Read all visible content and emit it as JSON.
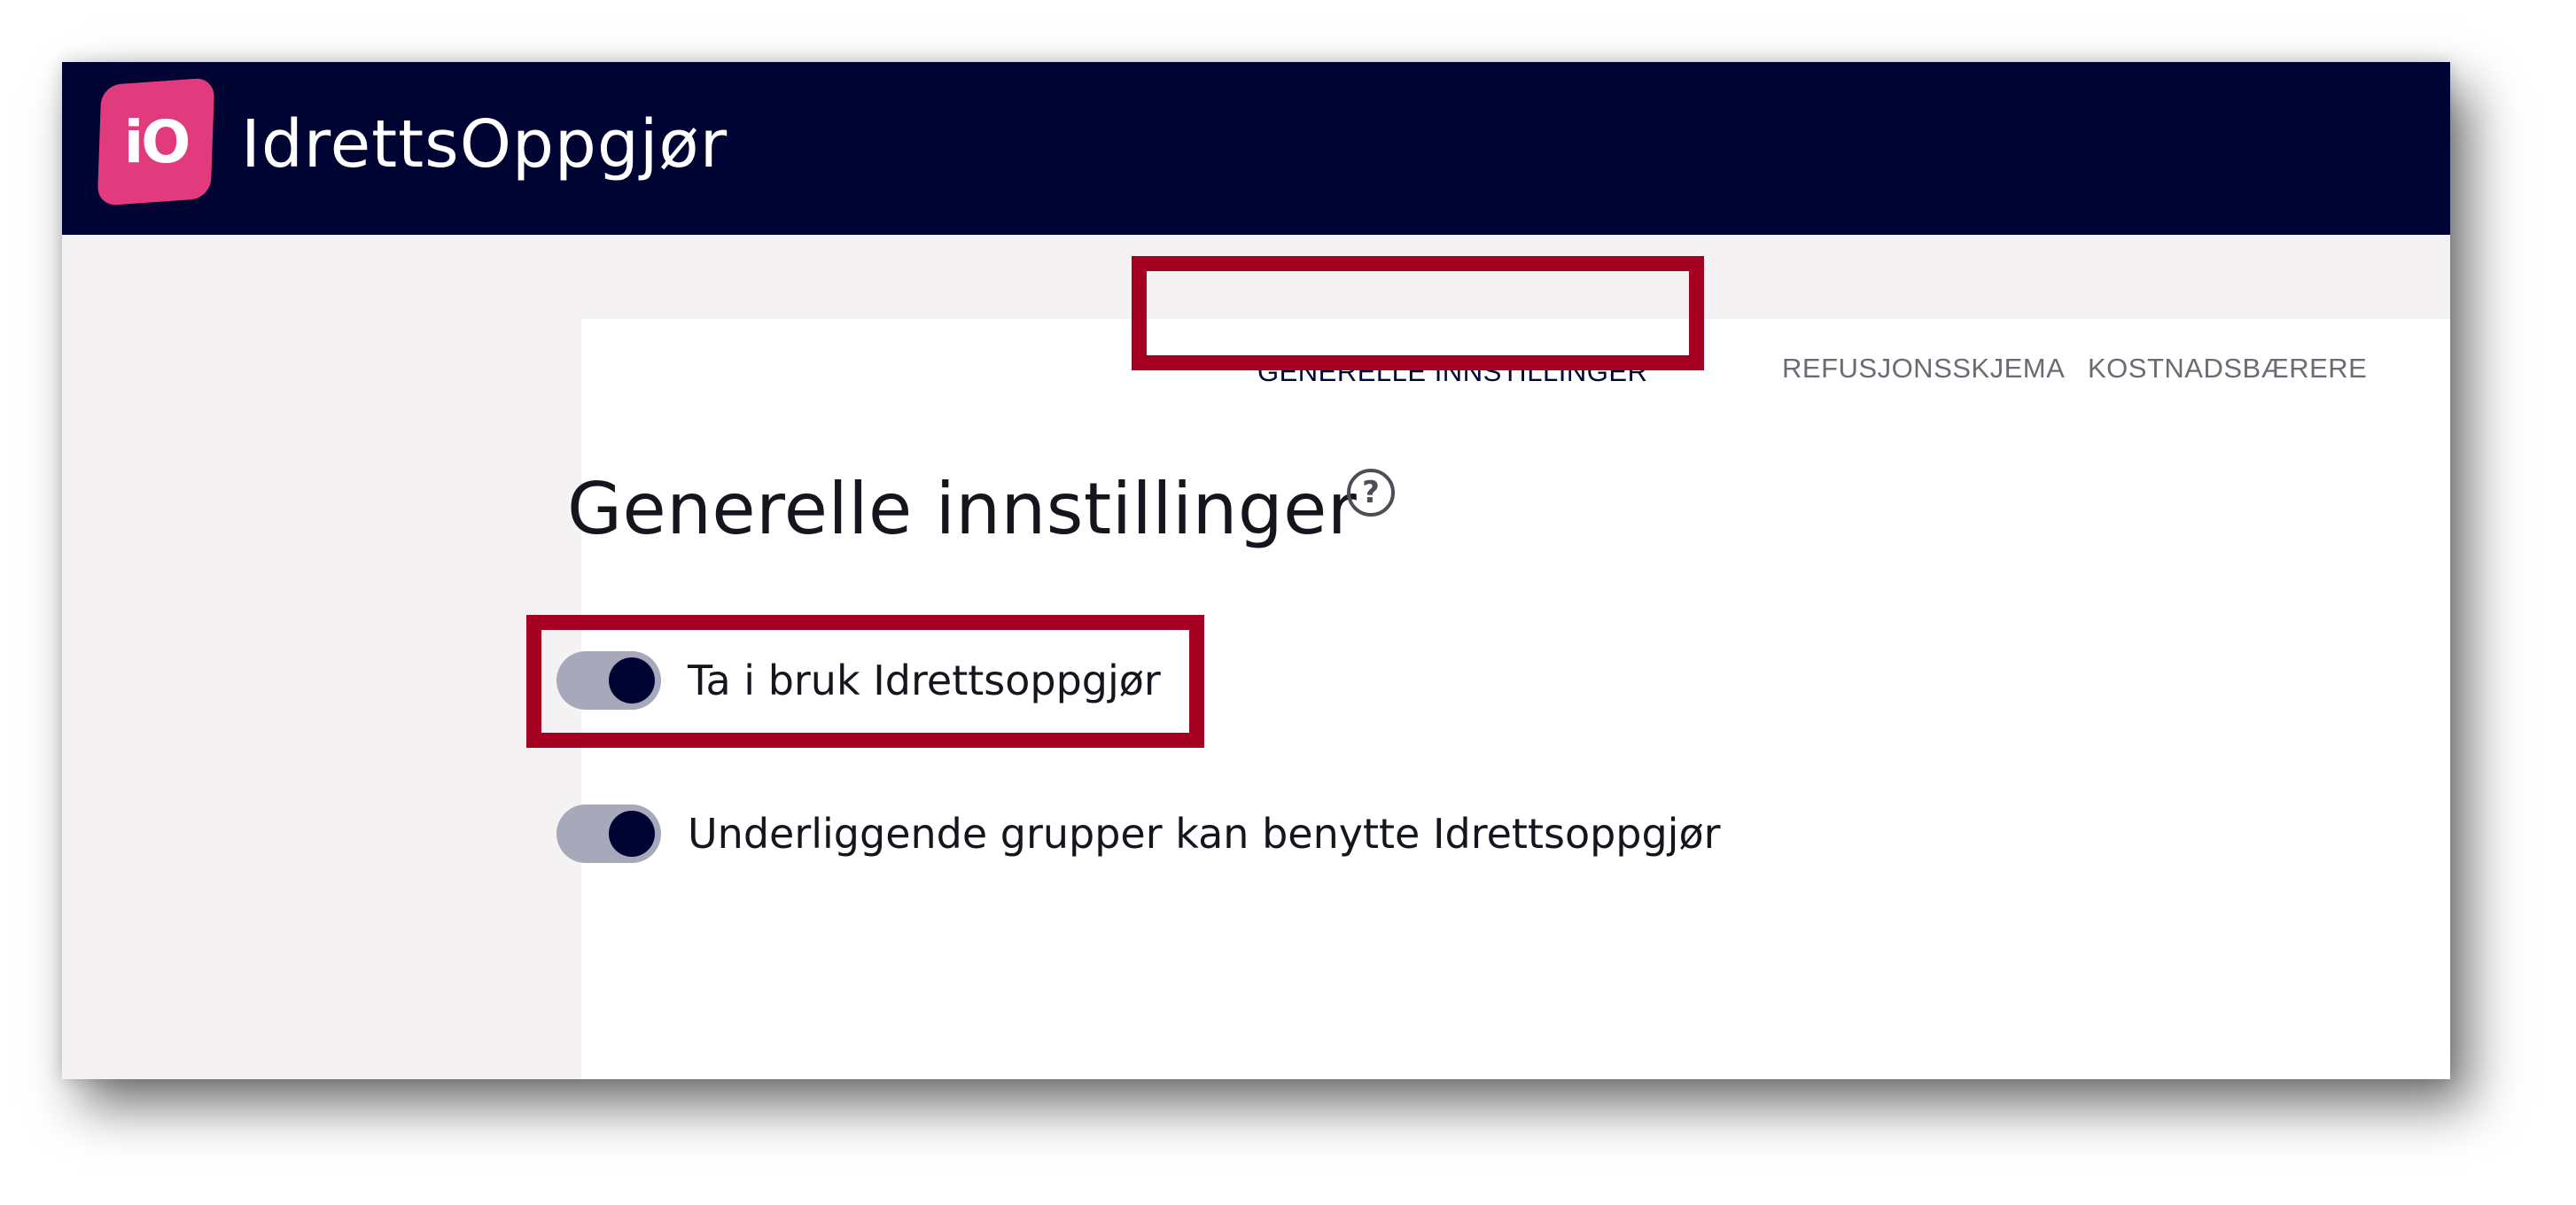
{
  "app": {
    "logo_text": "iO",
    "brand_name": "IdrettsOppgjør"
  },
  "tabs": [
    {
      "label": "GENERELLE INNSTILLINGER",
      "active": true
    },
    {
      "label": "REFUSJONSSKJEMA",
      "active": false
    },
    {
      "label": "KOSTNADSBÆRERE",
      "active": false
    }
  ],
  "page": {
    "title": "Generelle innstillinger",
    "help_symbol": "?"
  },
  "settings": [
    {
      "label": "Ta i bruk Idrettsoppgjør",
      "enabled": true
    },
    {
      "label": "Underliggende grupper kan benytte Idrettsoppgjør",
      "enabled": true
    }
  ],
  "colors": {
    "header_background": "#000433",
    "logo_accent": "#e23b7d",
    "highlight_border": "#a50021",
    "toggle_track": "#a7a8ba",
    "toggle_knob": "#000433"
  },
  "icons": {
    "help": "help-circle-icon"
  }
}
